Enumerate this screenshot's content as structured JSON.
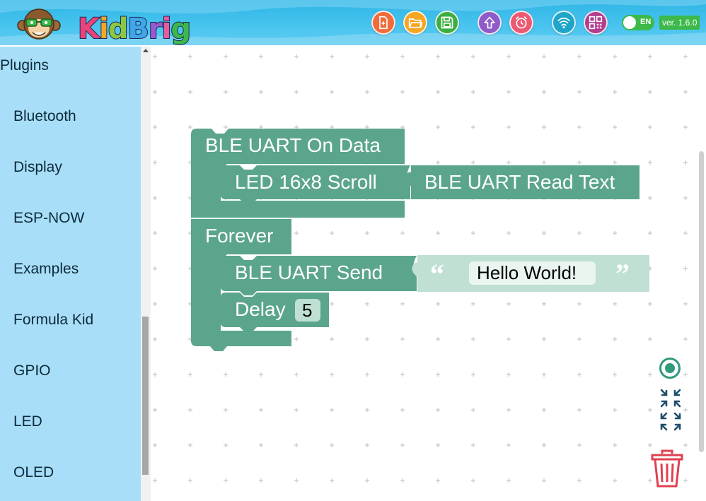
{
  "app": {
    "logo_text": "KidBright",
    "logo_colors": [
      "#e8447a",
      "#f6a623",
      "#8fc640",
      "#42a5e8",
      "#9b59d0",
      "#ec5a9b",
      "#3cb94a",
      "#f5c12a",
      "#f57c2b"
    ],
    "language": "EN",
    "version": "ver. 1.6.0"
  },
  "toolbar": {
    "buttons": [
      {
        "name": "new-file-button",
        "icon": "new-file-icon",
        "color": "#f26b3a"
      },
      {
        "name": "open-file-button",
        "icon": "open-folder-icon",
        "color": "#f6a623"
      },
      {
        "name": "save-button",
        "icon": "save-icon",
        "color": "#3cae3f"
      },
      {
        "name": "upload-button",
        "icon": "upload-icon",
        "color": "#8e5bc9"
      },
      {
        "name": "alarm-button",
        "icon": "alarm-clock-icon",
        "color": "#ec5a72"
      },
      {
        "name": "wifi-button",
        "icon": "wifi-icon",
        "color": "#1ea5c9"
      },
      {
        "name": "qr-code-button",
        "icon": "qr-code-icon",
        "color": "#b23c8e"
      }
    ]
  },
  "sidebar": {
    "heading": "Plugins",
    "items": [
      {
        "label": "Bluetooth"
      },
      {
        "label": "Display"
      },
      {
        "label": "ESP-NOW"
      },
      {
        "label": "Examples"
      },
      {
        "label": "Formula Kid"
      },
      {
        "label": "GPIO"
      },
      {
        "label": "LED"
      },
      {
        "label": "OLED"
      }
    ]
  },
  "workspace": {
    "block_color": "#5ba58c",
    "string_color": "#bfe0d3",
    "blocks": {
      "ble_on_data": "BLE UART On Data",
      "led_scroll": "LED 16x8 Scroll",
      "ble_read_text": "BLE UART Read Text",
      "forever": "Forever",
      "ble_send": "BLE UART Send",
      "string_value": "Hello World!",
      "delay": "Delay",
      "delay_value": "5"
    },
    "controls": {
      "center": "recenter-icon",
      "zoom": "zoom-to-fit-icon",
      "trash": "trash-icon"
    }
  }
}
